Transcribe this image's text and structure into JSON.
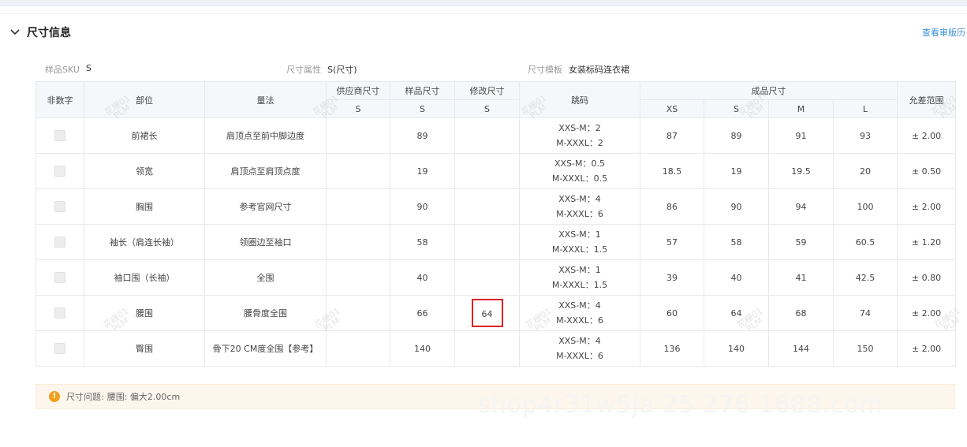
{
  "section": {
    "title": "尺寸信息",
    "history_link": "查看审版历"
  },
  "info": [
    {
      "label": "样品SKU",
      "value": "S"
    },
    {
      "label": "尺寸属性",
      "value": "S(尺寸)"
    },
    {
      "label": "尺寸模板",
      "value": "女装标码连衣裙"
    }
  ],
  "table": {
    "headers": {
      "non_numeric": "非数字",
      "part": "部位",
      "method": "量法",
      "supplier_size": "供应商尺寸",
      "sample_size": "样品尺寸",
      "modified_size": "修改尺寸",
      "jump": "跳码",
      "finished_size": "成品尺寸",
      "tolerance": "允差范围",
      "supplier_sub": "S",
      "sample_sub": "S",
      "modified_sub": "S",
      "sizes": [
        "XS",
        "S",
        "M",
        "L"
      ]
    },
    "rows": [
      {
        "part": "前裙长",
        "method": "肩顶点至前中脚边度",
        "supplier": "",
        "sample": "89",
        "modified": "",
        "jump1": "XXS-M：2",
        "jump2": "M-XXXL：2",
        "xs": "87",
        "s": "89",
        "m": "91",
        "l": "93",
        "tol": "± 2.00"
      },
      {
        "part": "领宽",
        "method": "肩顶点至肩顶点度",
        "supplier": "",
        "sample": "19",
        "modified": "",
        "jump1": "XXS-M：0.5",
        "jump2": "M-XXXL：0.5",
        "xs": "18.5",
        "s": "19",
        "m": "19.5",
        "l": "20",
        "tol": "± 0.50"
      },
      {
        "part": "胸围",
        "method": "参考官网尺寸",
        "supplier": "",
        "sample": "90",
        "modified": "",
        "jump1": "XXS-M：4",
        "jump2": "M-XXXL：6",
        "xs": "86",
        "s": "90",
        "m": "94",
        "l": "100",
        "tol": "± 2.00"
      },
      {
        "part": "袖长（肩连长袖）",
        "method": "领圈边至袖口",
        "supplier": "",
        "sample": "58",
        "modified": "",
        "jump1": "XXS-M：1",
        "jump2": "M-XXXL：1.5",
        "xs": "57",
        "s": "58",
        "m": "59",
        "l": "60.5",
        "tol": "± 1.20"
      },
      {
        "part": "袖口围（长袖）",
        "method": "全围",
        "supplier": "",
        "sample": "40",
        "modified": "",
        "jump1": "XXS-M：1",
        "jump2": "M-XXXL：1.5",
        "xs": "39",
        "s": "40",
        "m": "41",
        "l": "42.5",
        "tol": "± 0.80"
      },
      {
        "part": "腰围",
        "method": "腰骨度全围",
        "supplier": "",
        "sample": "66",
        "modified": "64",
        "jump1": "XXS-M：4",
        "jump2": "M-XXXL：6",
        "xs": "60",
        "s": "64",
        "m": "68",
        "l": "74",
        "tol": "± 2.00"
      },
      {
        "part": "臀围",
        "method": "骨下20 CM度全围【参考】",
        "supplier": "",
        "sample": "140",
        "modified": "",
        "jump1": "XXS-M：4",
        "jump2": "M-XXXL：6",
        "xs": "136",
        "s": "140",
        "m": "144",
        "l": "150",
        "tol": "± 2.00"
      }
    ]
  },
  "notice": {
    "label": "尺寸问题:",
    "text": "腰围: 偏大2.00cm"
  },
  "watermark": {
    "line1": "花栅01",
    "line2": "PLM"
  },
  "bg_watermark": "shop4r31w5ja 25 276 1688.com",
  "colors": {
    "accent_link": "#3a8fd8",
    "highlight_border": "#e02020",
    "warning": "#f0a020"
  }
}
